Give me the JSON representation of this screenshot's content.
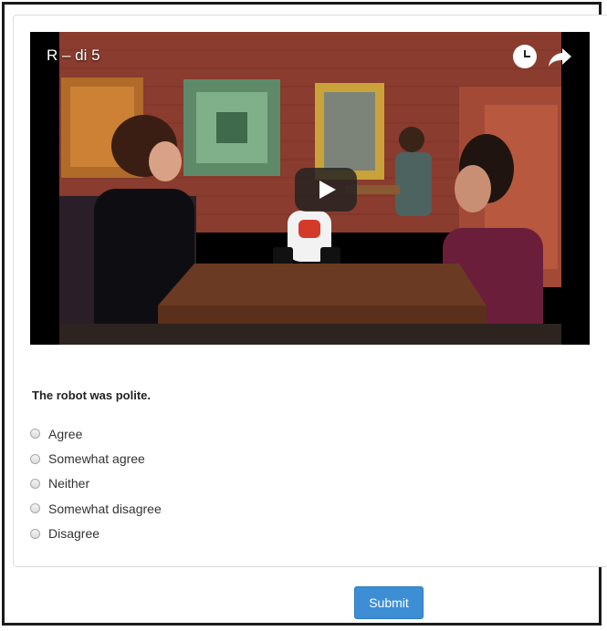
{
  "video": {
    "title": "R – di 5",
    "icons": [
      "watch-later-icon",
      "share-icon",
      "play-icon"
    ]
  },
  "survey": {
    "question": "The robot was polite.",
    "options": [
      "Agree",
      "Somewhat agree",
      "Neither",
      "Somewhat disagree",
      "Disagree"
    ]
  },
  "submit_label": "Submit",
  "colors": {
    "submit": "#3d8ed4",
    "wall": "#8a3c2e",
    "table": "#6b3a22"
  }
}
